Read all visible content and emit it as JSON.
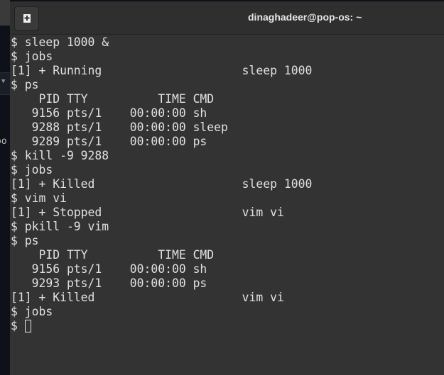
{
  "window": {
    "title": "dinaghadeer@pop-os: ~"
  },
  "background": {
    "partial_text": "oo"
  },
  "terminal": {
    "lines": [
      "$ sleep 1000 &",
      "$ jobs",
      "[1] + Running                    sleep 1000",
      "$ ps",
      "    PID TTY          TIME CMD",
      "   9156 pts/1    00:00:00 sh",
      "   9288 pts/1    00:00:00 sleep",
      "   9289 pts/1    00:00:00 ps",
      "$ kill -9 9288",
      "$ jobs",
      "[1] + Killed                     sleep 1000",
      "$ vim vi",
      "[1] + Stopped                    vim vi",
      "$ pkill -9 vim",
      "$ ps",
      "    PID TTY          TIME CMD",
      "   9156 pts/1    00:00:00 sh",
      "   9293 pts/1    00:00:00 ps",
      "[1] + Killed                     vim vi",
      "$ jobs"
    ],
    "prompt": "$ "
  }
}
